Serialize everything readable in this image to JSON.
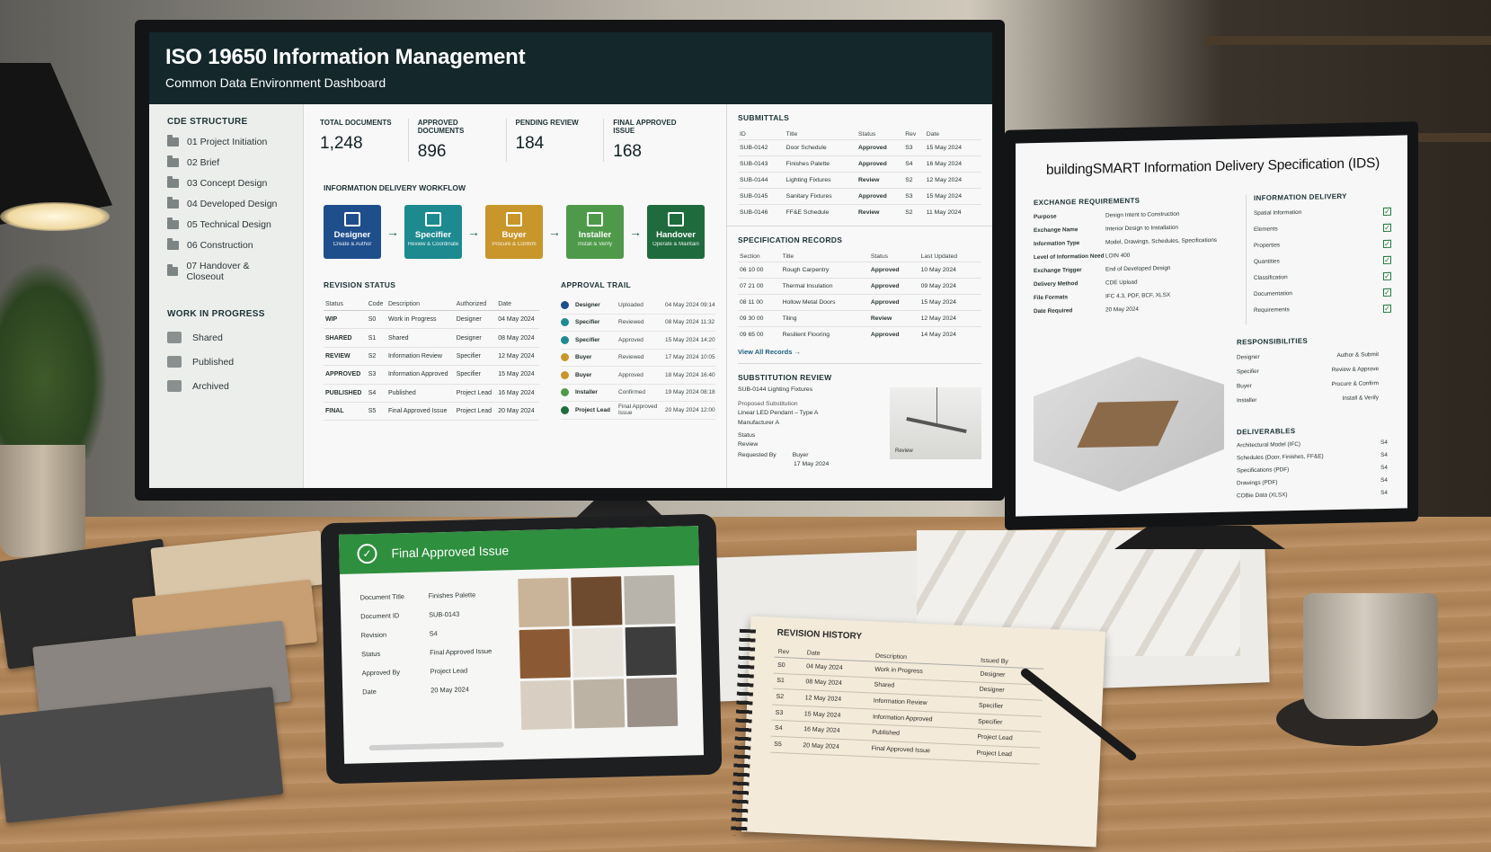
{
  "dashboard": {
    "title": "ISO 19650 Information Management",
    "subtitle": "Common Data Environment Dashboard",
    "cde_title": "CDE STRUCTURE",
    "folders": [
      "01 Project Initiation",
      "02 Brief",
      "03 Concept Design",
      "04 Developed Design",
      "05 Technical Design",
      "06 Construction",
      "07 Handover & Closeout"
    ],
    "wip_title": "WORK IN PROGRESS",
    "wip_items": [
      "Shared",
      "Published",
      "Archived"
    ],
    "stats": [
      {
        "label": "TOTAL DOCUMENTS",
        "value": "1,248"
      },
      {
        "label": "APPROVED DOCUMENTS",
        "value": "896"
      },
      {
        "label": "PENDING REVIEW",
        "value": "184"
      },
      {
        "label": "FINAL APPROVED ISSUE",
        "value": "168"
      }
    ],
    "workflow_title": "INFORMATION DELIVERY WORKFLOW",
    "workflow": [
      {
        "title": "Designer",
        "sub": "Create & Author",
        "color": "#1f4e8c"
      },
      {
        "title": "Specifier",
        "sub": "Review & Coordinate",
        "color": "#1d8a90"
      },
      {
        "title": "Buyer",
        "sub": "Procure & Confirm",
        "color": "#c8962a"
      },
      {
        "title": "Installer",
        "sub": "Install & Verify",
        "color": "#4e9a4a"
      },
      {
        "title": "Handover",
        "sub": "Operate & Maintain",
        "color": "#1f6b3d"
      }
    ],
    "revision_title": "REVISION STATUS",
    "revision_headers": [
      "Status",
      "Code",
      "Description",
      "Authorized",
      "Date"
    ],
    "revision_rows": [
      [
        "WIP",
        "S0",
        "Work in Progress",
        "Designer",
        "04 May 2024"
      ],
      [
        "SHARED",
        "S1",
        "Shared",
        "Designer",
        "08 May 2024"
      ],
      [
        "REVIEW",
        "S2",
        "Information Review",
        "Specifier",
        "12 May 2024"
      ],
      [
        "APPROVED",
        "S3",
        "Information Approved",
        "Specifier",
        "15 May 2024"
      ],
      [
        "PUBLISHED",
        "S4",
        "Published",
        "Project Lead",
        "16 May 2024"
      ],
      [
        "FINAL",
        "S5",
        "Final Approved Issue",
        "Project Lead",
        "20 May 2024"
      ]
    ],
    "approval_title": "APPROVAL TRAIL",
    "approval_rows": [
      {
        "who": "Designer",
        "action": "Uploaded",
        "date": "04 May 2024 09:14",
        "color": "#1f4e8c"
      },
      {
        "who": "Specifier",
        "action": "Reviewed",
        "date": "08 May 2024 11:32",
        "color": "#1d8a90"
      },
      {
        "who": "Specifier",
        "action": "Approved",
        "date": "15 May 2024 14:20",
        "color": "#1d8a90"
      },
      {
        "who": "Buyer",
        "action": "Reviewed",
        "date": "17 May 2024 10:05",
        "color": "#c8962a"
      },
      {
        "who": "Buyer",
        "action": "Approved",
        "date": "18 May 2024 16:40",
        "color": "#c8962a"
      },
      {
        "who": "Installer",
        "action": "Confirmed",
        "date": "19 May 2024 08:18",
        "color": "#4e9a4a"
      },
      {
        "who": "Project Lead",
        "action": "Final Approved Issue",
        "date": "20 May 2024 12:00",
        "color": "#1f6b3d"
      }
    ],
    "submittals_title": "SUBMITTALS",
    "submittal_headers": [
      "ID",
      "Title",
      "Status",
      "Rev",
      "Date"
    ],
    "submittal_rows": [
      [
        "SUB-0142",
        "Door Schedule",
        "Approved",
        "S3",
        "15 May 2024"
      ],
      [
        "SUB-0143",
        "Finishes Palette",
        "Approved",
        "S4",
        "16 May 2024"
      ],
      [
        "SUB-0144",
        "Lighting Fixtures",
        "Review",
        "S2",
        "12 May 2024"
      ],
      [
        "SUB-0145",
        "Sanitary Fixtures",
        "Approved",
        "S3",
        "15 May 2024"
      ],
      [
        "SUB-0146",
        "FF&E Schedule",
        "Review",
        "S2",
        "11 May 2024"
      ]
    ],
    "spec_title": "SPECIFICATION RECORDS",
    "spec_headers": [
      "Section",
      "Title",
      "Status",
      "Last Updated"
    ],
    "spec_rows": [
      [
        "06 10 00",
        "Rough Carpentry",
        "Approved",
        "10 May 2024"
      ],
      [
        "07 21 00",
        "Thermal Insulation",
        "Approved",
        "09 May 2024"
      ],
      [
        "08 11 00",
        "Hollow Metal Doors",
        "Approved",
        "15 May 2024"
      ],
      [
        "09 30 00",
        "Tiling",
        "Review",
        "12 May 2024"
      ],
      [
        "09 65 00",
        "Resilient Flooring",
        "Approved",
        "14 May 2024"
      ]
    ],
    "view_all": "View All Records →",
    "subst_title": "SUBSTITUTION REVIEW",
    "subst_item": "SUB-0144  Lighting Fixtures",
    "subst_prop_label": "Proposed Substitution",
    "subst_prop_value": "Linear LED Pendant – Type A",
    "subst_manufacturer": "Manufacturer A",
    "subst_status_label": "Status",
    "subst_status_value": "Review",
    "subst_req_label": "Requested By",
    "subst_req_who": "Buyer",
    "subst_req_date": "17 May 2024",
    "subst_img_label": "Review"
  },
  "ids": {
    "title": "buildingSMART Information Delivery Specification (IDS)",
    "exchange_title": "EXCHANGE REQUIREMENTS",
    "exchange": [
      [
        "Purpose",
        "Design Intent to Construction"
      ],
      [
        "Exchange Name",
        "Interior Design to Installation"
      ],
      [
        "Information Type",
        "Model, Drawings, Schedules, Specifications"
      ],
      [
        "Level of Information Need",
        "LOIN 400"
      ],
      [
        "Exchange Trigger",
        "End of Developed Design"
      ],
      [
        "Delivery Method",
        "CDE Upload"
      ],
      [
        "File Formats",
        "IFC 4.3, PDF, BCF, XLSX"
      ],
      [
        "Date Required",
        "20 May 2024"
      ]
    ],
    "delivery_title": "INFORMATION DELIVERY",
    "delivery": [
      "Spatial Information",
      "Elements",
      "Properties",
      "Quantities",
      "Classification",
      "Documentation",
      "Requirements"
    ],
    "resp_title": "RESPONSIBILITIES",
    "resp": [
      [
        "Designer",
        "Author & Submit"
      ],
      [
        "Specifier",
        "Review & Approve"
      ],
      [
        "Buyer",
        "Procure & Confirm"
      ],
      [
        "Installer",
        "Install & Verify"
      ]
    ],
    "deliv_title": "DELIVERABLES",
    "deliv": [
      [
        "Architectural Model (IFC)",
        "S4"
      ],
      [
        "Schedules (Door, Finishes, FF&E)",
        "S4"
      ],
      [
        "Specifications (PDF)",
        "S4"
      ],
      [
        "Drawings (PDF)",
        "S4"
      ],
      [
        "COBie Data (XLSX)",
        "S4"
      ]
    ]
  },
  "tablet": {
    "title": "Final Approved Issue",
    "fields": [
      [
        "Document Title",
        "Finishes Palette"
      ],
      [
        "Document ID",
        "SUB-0143"
      ],
      [
        "Revision",
        "S4"
      ],
      [
        "Status",
        "Final Approved Issue"
      ],
      [
        "Approved By",
        "Project Lead"
      ],
      [
        "Date",
        "20 May 2024"
      ]
    ],
    "swatch_colors": [
      "#c9b49a",
      "#6e4b2e",
      "#b9b4ab",
      "#8b5a34",
      "#e8e4dc",
      "#3d3d3d",
      "#d8cfc2",
      "#bdb3a4",
      "#9a9088"
    ]
  },
  "notebook": {
    "title": "REVISION HISTORY",
    "headers": [
      "Rev",
      "Date",
      "Description",
      "Issued By"
    ],
    "rows": [
      [
        "S0",
        "04 May 2024",
        "Work in Progress",
        "Designer"
      ],
      [
        "S1",
        "08 May 2024",
        "Shared",
        "Designer"
      ],
      [
        "S2",
        "12 May 2024",
        "Information Review",
        "Specifier"
      ],
      [
        "S3",
        "15 May 2024",
        "Information Approved",
        "Specifier"
      ],
      [
        "S4",
        "16 May 2024",
        "Published",
        "Project Lead"
      ],
      [
        "S5",
        "20 May 2024",
        "Final Approved Issue",
        "Project Lead"
      ]
    ]
  }
}
